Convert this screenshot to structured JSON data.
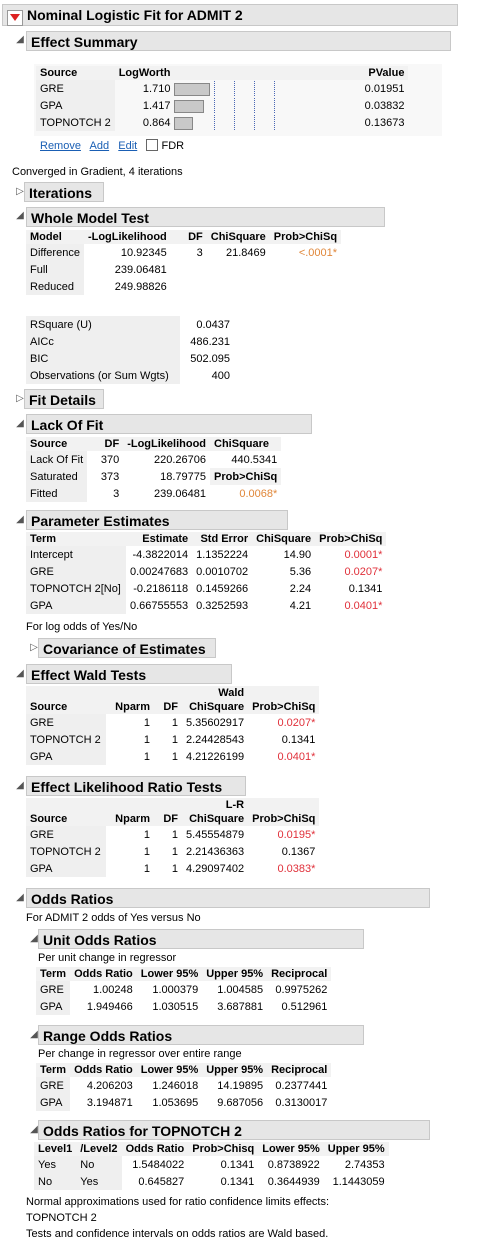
{
  "title": "Nominal Logistic Fit for ADMIT 2",
  "effect_summary": {
    "title": "Effect Summary",
    "cols": [
      "Source",
      "LogWorth",
      "PValue"
    ],
    "rows": [
      {
        "source": "GRE",
        "logworth": "1.710",
        "pvalue": "0.01951"
      },
      {
        "source": "GPA",
        "logworth": "1.417",
        "pvalue": "0.03832"
      },
      {
        "source": "TOPNOTCH 2",
        "logworth": "0.864",
        "pvalue": "0.13673"
      }
    ],
    "logworth_values": [
      1.71,
      1.417,
      0.864
    ],
    "buttons": [
      "Remove",
      "Add",
      "Edit"
    ],
    "fdr_label": "FDR"
  },
  "converged": "Converged in Gradient, 4 iterations",
  "iterations_title": "Iterations",
  "whole_model": {
    "title": "Whole Model Test",
    "cols": [
      "Model",
      "-LogLikelihood",
      "DF",
      "ChiSquare",
      "Prob>ChiSq"
    ],
    "rows": [
      [
        "Difference",
        "10.92345",
        "3",
        "21.8469",
        "<.0001*"
      ],
      [
        "Full",
        "239.06481",
        "",
        "",
        ""
      ],
      [
        "Reduced",
        "249.98826",
        "",
        "",
        ""
      ]
    ],
    "stats": [
      [
        "RSquare (U)",
        "0.0437"
      ],
      [
        "AICc",
        "486.231"
      ],
      [
        "BIC",
        "502.095"
      ],
      [
        "Observations (or Sum Wgts)",
        "400"
      ]
    ]
  },
  "fit_details_title": "Fit Details",
  "lack_of_fit": {
    "title": "Lack Of Fit",
    "cols": [
      "Source",
      "DF",
      "-LogLikelihood",
      "ChiSquare"
    ],
    "rows": [
      [
        "Lack Of Fit",
        "370",
        "220.26706",
        "440.5341"
      ],
      [
        "Saturated",
        "373",
        "18.79775",
        "Prob>ChiSq"
      ],
      [
        "Fitted",
        "3",
        "239.06481",
        "0.0068*"
      ]
    ]
  },
  "param_est": {
    "title": "Parameter Estimates",
    "cols": [
      "Term",
      "Estimate",
      "Std Error",
      "ChiSquare",
      "Prob>ChiSq"
    ],
    "rows": [
      [
        "Intercept",
        "-4.3822014",
        "1.1352224",
        "14.90",
        "0.0001*"
      ],
      [
        "GRE",
        "0.00247683",
        "0.0010702",
        "5.36",
        "0.0207*"
      ],
      [
        "TOPNOTCH 2[No]",
        "-0.2186118",
        "0.1459266",
        "2.24",
        "0.1341"
      ],
      [
        "GPA",
        "0.66755553",
        "0.3252593",
        "4.21",
        "0.0401*"
      ]
    ],
    "note": "For log odds of Yes/No",
    "cov_title": "Covariance of Estimates"
  },
  "wald": {
    "title": "Effect Wald Tests",
    "cols_top": [
      "",
      "",
      "",
      "Wald",
      ""
    ],
    "cols": [
      "Source",
      "Nparm",
      "DF",
      "ChiSquare",
      "Prob>ChiSq"
    ],
    "rows": [
      [
        "GRE",
        "1",
        "1",
        "5.35602917",
        "0.0207*"
      ],
      [
        "TOPNOTCH 2",
        "1",
        "1",
        "2.24428543",
        "0.1341"
      ],
      [
        "GPA",
        "1",
        "1",
        "4.21226199",
        "0.0401*"
      ]
    ]
  },
  "lr": {
    "title": "Effect Likelihood Ratio Tests",
    "cols_top": [
      "",
      "",
      "",
      "L-R",
      ""
    ],
    "cols": [
      "Source",
      "Nparm",
      "DF",
      "ChiSquare",
      "Prob>ChiSq"
    ],
    "rows": [
      [
        "GRE",
        "1",
        "1",
        "5.45554879",
        "0.0195*"
      ],
      [
        "TOPNOTCH 2",
        "1",
        "1",
        "2.21436363",
        "0.1367"
      ],
      [
        "GPA",
        "1",
        "1",
        "4.29097402",
        "0.0383*"
      ]
    ]
  },
  "odds": {
    "title": "Odds Ratios",
    "note": "For ADMIT 2 odds of Yes versus No",
    "unit": {
      "title": "Unit Odds Ratios",
      "note": "Per unit change in regressor",
      "cols": [
        "Term",
        "Odds Ratio",
        "Lower 95%",
        "Upper 95%",
        "Reciprocal"
      ],
      "rows": [
        [
          "GRE",
          "1.00248",
          "1.000379",
          "1.004585",
          "0.9975262"
        ],
        [
          "GPA",
          "1.949466",
          "1.030515",
          "3.687881",
          "0.512961"
        ]
      ]
    },
    "range": {
      "title": "Range Odds Ratios",
      "note": "Per change in regressor over entire range",
      "cols": [
        "Term",
        "Odds Ratio",
        "Lower 95%",
        "Upper 95%",
        "Reciprocal"
      ],
      "rows": [
        [
          "GRE",
          "4.206203",
          "1.246018",
          "14.19895",
          "0.2377441"
        ],
        [
          "GPA",
          "3.194871",
          "1.053695",
          "9.687056",
          "0.3130017"
        ]
      ]
    },
    "topnotch": {
      "title": "Odds Ratios for TOPNOTCH 2",
      "cols": [
        "Level1",
        "/Level2",
        "Odds Ratio",
        "Prob>Chisq",
        "Lower 95%",
        "Upper 95%"
      ],
      "rows": [
        [
          "Yes",
          "No",
          "1.5484022",
          "0.1341",
          "0.8738922",
          "2.74353"
        ],
        [
          "No",
          "Yes",
          "0.645827",
          "0.1341",
          "0.3644939",
          "1.1443059"
        ]
      ]
    },
    "footnote1": "Normal approximations used for ratio confidence limits effects:",
    "footnote2": "TOPNOTCH 2",
    "footnote3": "Tests and confidence intervals on odds ratios are Wald based."
  },
  "colors": {
    "significant": "#e0303a",
    "highlight": "#e0873a",
    "bar": "#c9c9c9",
    "header_bg": "#e6e6e6"
  },
  "icons": [
    "red-triangle-menu-icon",
    "disclosure-open-icon",
    "disclosure-closed-icon",
    "checkbox-icon"
  ]
}
